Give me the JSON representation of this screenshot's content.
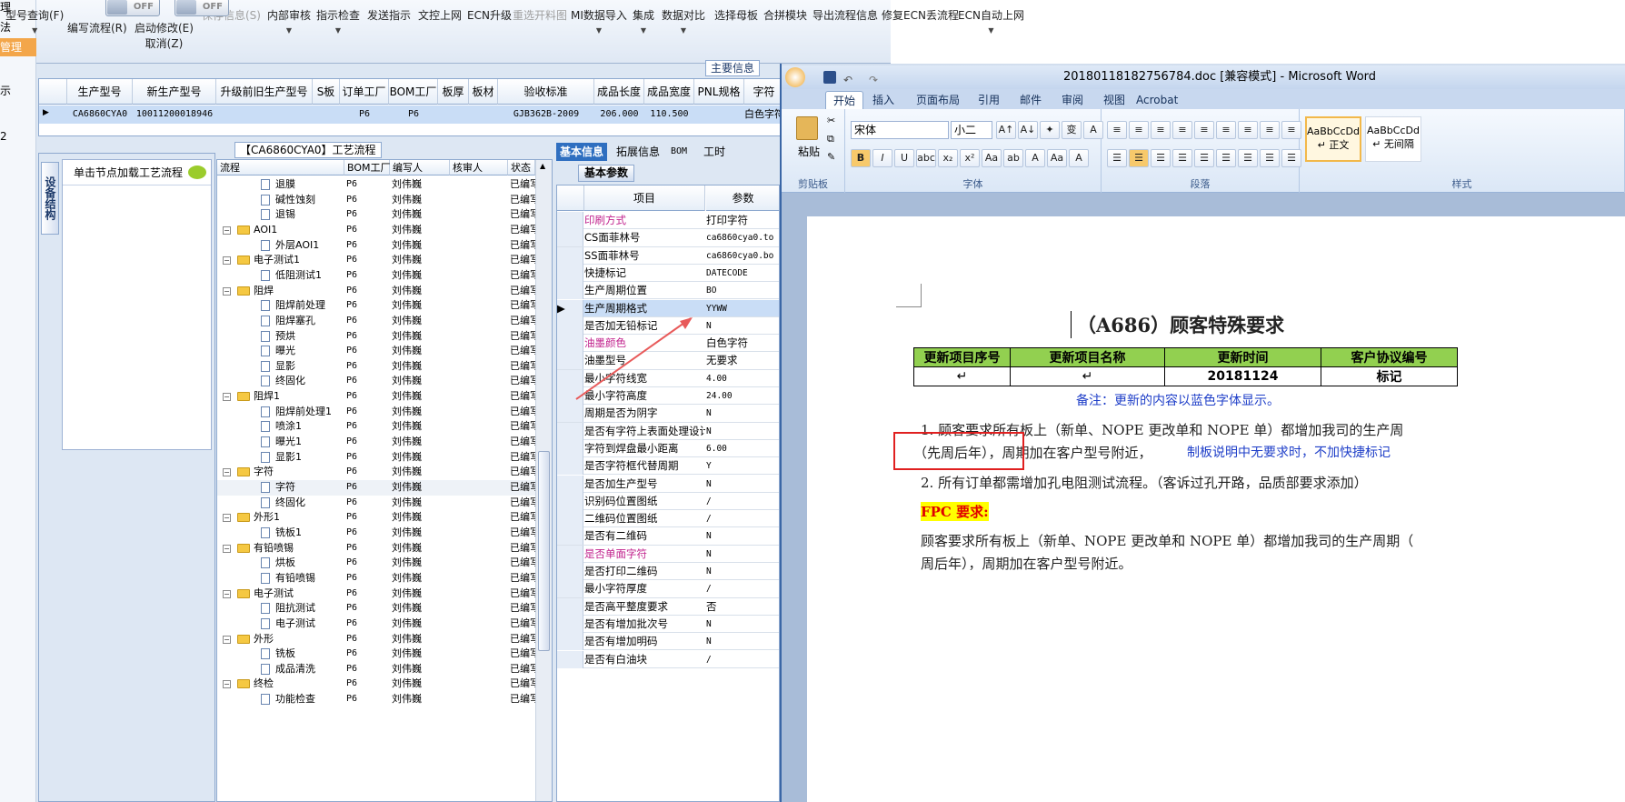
{
  "left_strip": [
    "理",
    "法",
    "管理",
    "示",
    "2"
  ],
  "toolbar": {
    "items": [
      {
        "label": "型号查询(F)",
        "dis": false,
        "dd": true
      },
      {
        "label": "编写流程(R)",
        "dis": false,
        "dd": false
      },
      {
        "label": "启动修改(E)",
        "sub": "取消(Z)",
        "dis": false
      },
      {
        "label": "保存信息(S)",
        "dis": true
      },
      {
        "label": "内部审核",
        "dis": false,
        "dd": true
      },
      {
        "label": "指示检查",
        "dis": false,
        "dd": true
      },
      {
        "label": "发送指示",
        "dis": false
      },
      {
        "label": "文控上网",
        "dis": false
      },
      {
        "label": "ECN升级",
        "dis": false
      },
      {
        "label": "重选开料图",
        "dis": true
      },
      {
        "label": "MI数据导入",
        "dis": false,
        "dd": true
      },
      {
        "label": "集成",
        "dis": false,
        "dd": true
      },
      {
        "label": "数据对比",
        "dis": false,
        "dd": true
      },
      {
        "label": "选择母板",
        "dis": false
      },
      {
        "label": "合拼模块",
        "dis": false
      },
      {
        "label": "导出流程信息",
        "dis": false
      },
      {
        "label": "修复ECN丢流程",
        "dis": false
      },
      {
        "label": "ECN自动上网",
        "dis": false,
        "dd": true
      }
    ],
    "toggle_label": "OFF"
  },
  "main_info_title": "主要信息",
  "upper_grid": {
    "headers": [
      "生产型号",
      "新生产型号",
      "升级前旧生产型号",
      "S板",
      "订单工厂",
      "BOM工厂",
      "板厚",
      "板材",
      "验收标准",
      "成品长度",
      "成品宽度",
      "PNL规格",
      "字符"
    ],
    "row": [
      "CA6860CYA0",
      "10011200018946",
      "",
      "",
      "P6",
      "P6",
      "",
      "",
      "GJB362B-2009",
      "206.000",
      "110.500",
      "",
      "白色字符"
    ]
  },
  "process_title": "【CA6860CYA0】工艺流程",
  "vtab_label": "设备结构",
  "click_hint": "单击节点加载工艺流程",
  "tree": {
    "headers": [
      "流程",
      "BOM工厂",
      "编写人",
      "核审人",
      "状态"
    ],
    "rows": [
      {
        "n": "退膜",
        "lvl": 2,
        "c": "P6",
        "w": "刘伟巍",
        "s": "已编写"
      },
      {
        "n": "碱性蚀刻",
        "lvl": 2,
        "c": "P6",
        "w": "刘伟巍",
        "s": "已编写"
      },
      {
        "n": "退锡",
        "lvl": 2,
        "c": "P6",
        "w": "刘伟巍",
        "s": "已编写"
      },
      {
        "n": "AOI1",
        "lvl": 1,
        "c": "P6",
        "w": "刘伟巍",
        "s": "已编写"
      },
      {
        "n": "外层AOI1",
        "lvl": 2,
        "c": "P6",
        "w": "刘伟巍",
        "s": "已编写"
      },
      {
        "n": "电子测试1",
        "lvl": 1,
        "c": "P6",
        "w": "刘伟巍",
        "s": "已编写"
      },
      {
        "n": "低阻测试1",
        "lvl": 2,
        "c": "P6",
        "w": "刘伟巍",
        "s": "已编写"
      },
      {
        "n": "阻焊",
        "lvl": 1,
        "c": "P6",
        "w": "刘伟巍",
        "s": "已编写"
      },
      {
        "n": "阻焊前处理",
        "lvl": 2,
        "c": "P6",
        "w": "刘伟巍",
        "s": "已编写"
      },
      {
        "n": "阻焊塞孔",
        "lvl": 2,
        "c": "P6",
        "w": "刘伟巍",
        "s": "已编写"
      },
      {
        "n": "预烘",
        "lvl": 2,
        "c": "P6",
        "w": "刘伟巍",
        "s": "已编写"
      },
      {
        "n": "曝光",
        "lvl": 2,
        "c": "P6",
        "w": "刘伟巍",
        "s": "已编写"
      },
      {
        "n": "显影",
        "lvl": 2,
        "c": "P6",
        "w": "刘伟巍",
        "s": "已编写"
      },
      {
        "n": "终固化",
        "lvl": 2,
        "c": "P6",
        "w": "刘伟巍",
        "s": "已编写"
      },
      {
        "n": "阻焊1",
        "lvl": 1,
        "c": "P6",
        "w": "刘伟巍",
        "s": "已编写"
      },
      {
        "n": "阻焊前处理1",
        "lvl": 2,
        "c": "P6",
        "w": "刘伟巍",
        "s": "已编写"
      },
      {
        "n": "喷涂1",
        "lvl": 2,
        "c": "P6",
        "w": "刘伟巍",
        "s": "已编写"
      },
      {
        "n": "曝光1",
        "lvl": 2,
        "c": "P6",
        "w": "刘伟巍",
        "s": "已编写"
      },
      {
        "n": "显影1",
        "lvl": 2,
        "c": "P6",
        "w": "刘伟巍",
        "s": "已编写"
      },
      {
        "n": "字符",
        "lvl": 1,
        "c": "P6",
        "w": "刘伟巍",
        "s": "已编写"
      },
      {
        "n": "字符",
        "lvl": 2,
        "c": "P6",
        "w": "刘伟巍",
        "s": "已编写",
        "sel": true
      },
      {
        "n": "终固化",
        "lvl": 2,
        "c": "P6",
        "w": "刘伟巍",
        "s": "已编写"
      },
      {
        "n": "外形1",
        "lvl": 1,
        "c": "P6",
        "w": "刘伟巍",
        "s": "已编写"
      },
      {
        "n": "铣板1",
        "lvl": 2,
        "c": "P6",
        "w": "刘伟巍",
        "s": "已编写"
      },
      {
        "n": "有铅喷锡",
        "lvl": 1,
        "c": "P6",
        "w": "刘伟巍",
        "s": "已编写"
      },
      {
        "n": "烘板",
        "lvl": 2,
        "c": "P6",
        "w": "刘伟巍",
        "s": "已编写"
      },
      {
        "n": "有铅喷锡",
        "lvl": 2,
        "c": "P6",
        "w": "刘伟巍",
        "s": "已编写"
      },
      {
        "n": "电子测试",
        "lvl": 1,
        "c": "P6",
        "w": "刘伟巍",
        "s": "已编写"
      },
      {
        "n": "阻抗测试",
        "lvl": 2,
        "c": "P6",
        "w": "刘伟巍",
        "s": "已编写"
      },
      {
        "n": "电子测试",
        "lvl": 2,
        "c": "P6",
        "w": "刘伟巍",
        "s": "已编写"
      },
      {
        "n": "外形",
        "lvl": 1,
        "c": "P6",
        "w": "刘伟巍",
        "s": "已编写"
      },
      {
        "n": "铣板",
        "lvl": 2,
        "c": "P6",
        "w": "刘伟巍",
        "s": "已编写"
      },
      {
        "n": "成品清洗",
        "lvl": 2,
        "c": "P6",
        "w": "刘伟巍",
        "s": "已编写"
      },
      {
        "n": "终检",
        "lvl": 1,
        "c": "P6",
        "w": "刘伟巍",
        "s": "已编写"
      },
      {
        "n": "功能检查",
        "lvl": 2,
        "c": "P6",
        "w": "刘伟巍",
        "s": "已编写"
      }
    ]
  },
  "param_tabs": [
    "基本信息",
    "拓展信息",
    "BOM",
    "工时"
  ],
  "param_subtab": "基本参数",
  "param_headers": [
    "项目",
    "参数"
  ],
  "params": [
    {
      "k": "印刷方式",
      "v": "打印字符",
      "pink": true,
      "cn": true
    },
    {
      "k": "CS面菲林号",
      "v": "ca6860cya0.to"
    },
    {
      "k": "SS面菲林号",
      "v": "ca6860cya0.bo"
    },
    {
      "k": "快捷标记",
      "v": "DATECODE"
    },
    {
      "k": "生产周期位置",
      "v": "BO"
    },
    {
      "k": "生产周期格式",
      "v": "YYWW",
      "sel": true
    },
    {
      "k": "是否加无铅标记",
      "v": "N"
    },
    {
      "k": "油墨颜色",
      "v": "白色字符",
      "pink": true,
      "cn": true
    },
    {
      "k": "油墨型号",
      "v": "无要求",
      "cn": true
    },
    {
      "k": "最小字符线宽",
      "v": "4.00"
    },
    {
      "k": "最小字符高度",
      "v": "24.00"
    },
    {
      "k": "周期是否为阴字",
      "v": "N"
    },
    {
      "k": "是否有字符上表面处理设计",
      "v": "N"
    },
    {
      "k": "字符到焊盘最小距离",
      "v": "6.00"
    },
    {
      "k": "是否字符框代替周期",
      "v": "Y"
    },
    {
      "k": "是否加生产型号",
      "v": "N"
    },
    {
      "k": "识别码位置图纸",
      "v": "/"
    },
    {
      "k": "二维码位置图纸",
      "v": "/"
    },
    {
      "k": "是否有二维码",
      "v": "N"
    },
    {
      "k": "是否单面字符",
      "v": "N",
      "pink": true
    },
    {
      "k": "是否打印二维码",
      "v": "N"
    },
    {
      "k": "最小字符厚度",
      "v": "/"
    },
    {
      "k": "是否高平整度要求",
      "v": "否",
      "cn": true
    },
    {
      "k": "是否有增加批次号",
      "v": "N"
    },
    {
      "k": "是否有增加明码",
      "v": "N"
    },
    {
      "k": "是否有白油块",
      "v": "/"
    }
  ],
  "word": {
    "title": "20180118182756784.doc [兼容模式] - Microsoft Word",
    "tabs": [
      "开始",
      "插入",
      "页面布局",
      "引用",
      "邮件",
      "审阅",
      "视图",
      "Acrobat"
    ],
    "groups": [
      "剪贴板",
      "字体",
      "段落",
      "样式"
    ],
    "paste": "粘贴",
    "font": "宋体",
    "size": "小二",
    "styles": [
      {
        "t": "AaBbCcDd",
        "n": "↵ 正文"
      },
      {
        "t": "AaBbCcDd",
        "n": "↵ 无间隔"
      }
    ],
    "heading": "（A686）顾客特殊要求",
    "table_head": [
      "更新项目序号",
      "更新项目名称",
      "更新时间",
      "客户协议编号"
    ],
    "table_row": [
      "↵",
      "↵",
      "20181124",
      "标记"
    ],
    "note": "备注：更新的内容以蓝色字体显示。",
    "p1a": "1. 顾客要求所有板上（新单、NOPE 更改单和 NOPE 单）都增加我司的生产周",
    "p1b": "（先周后年），周期加在客户型号附近，",
    "p1c": "制板说明中无要求时，不加快捷标记",
    "p2": "2. 所有订单都需增加孔电阻测试流程。（客诉过孔开路，品质部要求添加）",
    "fpc": "FPC 要求:",
    "p3a": "顾客要求所有板上（新单、NOPE 更改单和 NOPE 单）都增加我司的生产周期（",
    "p3b": "周后年），周期加在客户型号附近。"
  }
}
